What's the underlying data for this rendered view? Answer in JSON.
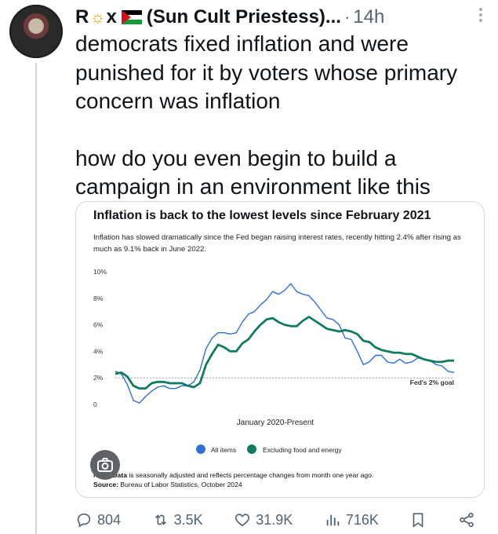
{
  "post": {
    "author_name": "R",
    "author_name_mid": "x",
    "author_handle_suffix": "(Sun Cult Priestess)...",
    "dot": "·",
    "time": "14h",
    "text_paragraph_1": "democrats fixed inflation and were punished for it by voters whose primary concern was inflation",
    "text_paragraph_2": "how do you even begin to build a campaign in an environment like this"
  },
  "chart_card": {
    "title": "Inflation is back to the lowest levels since February 2021",
    "subtitle": "Inflation has slowed dramatically since the Fed began raising interest rates, recently hitting 2.4% after rising as much as 9.1% back in June 2022.",
    "x_axis_label": "January 2020-Present",
    "goal_label": "Fed's 2% goal",
    "note_prefix": "Note: Data",
    "note_text": " is seasonally adjusted and reflects percentage changes from month one year ago.",
    "source_label": "Source:",
    "source_text": " Bureau of Labor Statistics, October 2024"
  },
  "chart_data": {
    "type": "line",
    "title": "Inflation is back to the lowest levels since February 2021",
    "xlabel": "January 2020-Present",
    "ylabel": "",
    "y_ticks": [
      "10%",
      "8%",
      "6%",
      "4%",
      "2%",
      "0"
    ],
    "ylim": [
      0,
      10
    ],
    "reference_line": {
      "value": 2,
      "label": "Fed's 2% goal"
    },
    "legend_placement": "bottom",
    "series": [
      {
        "name": "All items",
        "color": "#2f6fd6",
        "values": [
          2.5,
          2.3,
          1.5,
          0.3,
          0.1,
          0.6,
          1.0,
          1.3,
          1.4,
          1.2,
          1.2,
          1.4,
          1.4,
          1.7,
          2.6,
          4.2,
          5.0,
          5.4,
          5.4,
          5.3,
          5.4,
          6.2,
          6.8,
          7.0,
          7.5,
          7.9,
          8.5,
          8.3,
          8.6,
          9.1,
          8.5,
          8.3,
          8.2,
          7.7,
          7.1,
          6.5,
          6.4,
          6.0,
          5.0,
          4.9,
          4.0,
          3.0,
          3.2,
          3.7,
          3.7,
          3.2,
          3.1,
          3.4,
          3.1,
          3.2,
          3.5,
          3.4,
          3.3,
          3.0,
          2.9,
          2.5,
          2.4
        ]
      },
      {
        "name": "Excluding food and energy",
        "color": "#127a63",
        "values": [
          2.3,
          2.4,
          2.1,
          1.4,
          1.2,
          1.2,
          1.6,
          1.7,
          1.7,
          1.6,
          1.6,
          1.6,
          1.4,
          1.3,
          1.6,
          3.0,
          3.8,
          4.5,
          4.3,
          4.0,
          4.0,
          4.6,
          4.9,
          5.5,
          6.0,
          6.4,
          6.5,
          6.2,
          6.0,
          5.9,
          5.9,
          6.3,
          6.6,
          6.3,
          6.0,
          5.7,
          5.6,
          5.5,
          5.6,
          5.5,
          5.3,
          4.8,
          4.7,
          4.3,
          4.1,
          4.0,
          3.9,
          3.9,
          3.8,
          3.8,
          3.6,
          3.4,
          3.3,
          3.2,
          3.2,
          3.3,
          3.3
        ]
      }
    ]
  },
  "actions": {
    "replies": "804",
    "reposts": "3.5K",
    "likes": "31.9K",
    "views": "716K"
  },
  "colors": {
    "accent_blue": "#2f6fd6",
    "accent_green": "#127a63",
    "muted": "#536471"
  },
  "icons": [
    "sun-icon",
    "palestine-flag-icon",
    "more-icon",
    "camera-icon",
    "reply-icon",
    "repost-icon",
    "like-icon",
    "views-icon",
    "bookmark-icon",
    "share-icon"
  ]
}
